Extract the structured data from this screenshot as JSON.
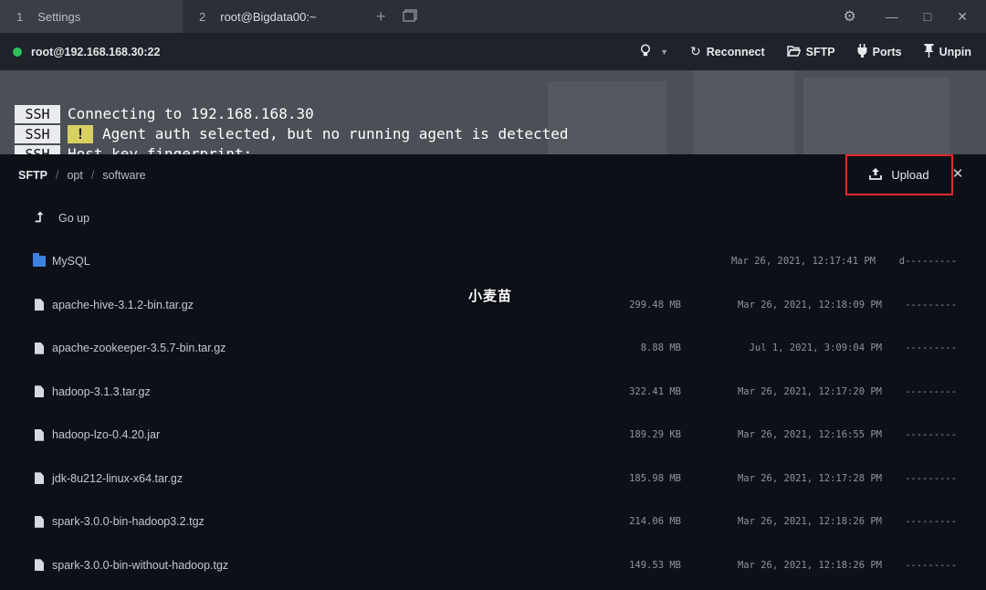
{
  "tabs": [
    {
      "num": "1",
      "label": "Settings"
    },
    {
      "num": "2",
      "label": "root@Bigdata00:~"
    }
  ],
  "tab_actions": {
    "new_tab_icon": "plus-icon",
    "split_icon": "window-icon"
  },
  "window_controls": {
    "gear": "gear-icon",
    "minimize": "—",
    "maximize": "□",
    "close": "✕"
  },
  "connection": {
    "host": "root@192.168.168.30:22",
    "status_color": "#2fc05a",
    "actions": {
      "hint_icon": "lightbulb-icon",
      "reconnect": "Reconnect",
      "sftp": "SFTP",
      "ports": "Ports",
      "unpin": "Unpin"
    }
  },
  "terminal": {
    "lines": [
      {
        "badge": "SSH",
        "text": "Connecting to 192.168.168.30"
      },
      {
        "badge": "SSH",
        "warn": "!",
        "text": "Agent auth selected, but no running agent is detected"
      },
      {
        "badge": "SSH",
        "text": "Host key fingerprint:"
      }
    ]
  },
  "sftp": {
    "breadcrumb": [
      "SFTP",
      "opt",
      "software"
    ],
    "upload_label": "Upload",
    "go_up_label": "Go up",
    "items": [
      {
        "type": "folder",
        "name": "MySQL",
        "size": "",
        "date": "Mar 26, 2021, 12:17:41 PM",
        "perm": "d---------"
      },
      {
        "type": "file",
        "name": "apache-hive-3.1.2-bin.tar.gz",
        "size": "299.48 MB",
        "date": "Mar 26, 2021, 12:18:09 PM",
        "perm": "---------"
      },
      {
        "type": "file",
        "name": "apache-zookeeper-3.5.7-bin.tar.gz",
        "size": "8.88 MB",
        "date": "Jul 1, 2021, 3:09:04 PM",
        "perm": "---------"
      },
      {
        "type": "file",
        "name": "hadoop-3.1.3.tar.gz",
        "size": "322.41 MB",
        "date": "Mar 26, 2021, 12:17:20 PM",
        "perm": "---------"
      },
      {
        "type": "file",
        "name": "hadoop-lzo-0.4.20.jar",
        "size": "189.29 KB",
        "date": "Mar 26, 2021, 12:16:55 PM",
        "perm": "---------"
      },
      {
        "type": "file",
        "name": "jdk-8u212-linux-x64.tar.gz",
        "size": "185.98 MB",
        "date": "Mar 26, 2021, 12:17:28 PM",
        "perm": "---------"
      },
      {
        "type": "file",
        "name": "spark-3.0.0-bin-hadoop3.2.tgz",
        "size": "214.06 MB",
        "date": "Mar 26, 2021, 12:18:26 PM",
        "perm": "---------"
      },
      {
        "type": "file",
        "name": "spark-3.0.0-bin-without-hadoop.tgz",
        "size": "149.53 MB",
        "date": "Mar 26, 2021, 12:18:26 PM",
        "perm": "---------"
      }
    ]
  },
  "watermark": "小麦苗",
  "colors": {
    "upload_highlight": "#e3272a",
    "folder": "#3b82e0"
  }
}
